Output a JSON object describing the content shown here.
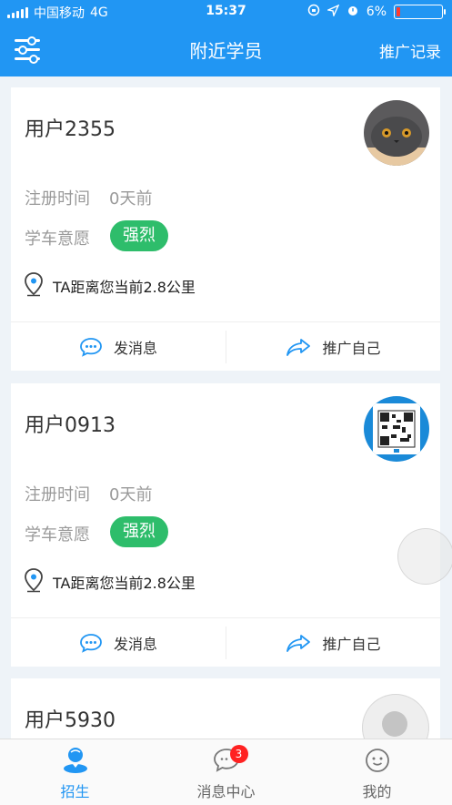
{
  "status_bar": {
    "carrier": "中国移动",
    "network": "4G",
    "time": "15:37",
    "battery": "6%",
    "battery_level": 0.06
  },
  "nav": {
    "title": "附近学员",
    "right_action": "推广记录",
    "menu_icon": "menu-sliders-icon"
  },
  "cards": [
    {
      "name": "用户2355",
      "reg_label": "注册时间",
      "reg_value": "0天前",
      "intent_label": "学车意愿",
      "intent_value": "强烈",
      "distance": "TA距离您当前2.8公里",
      "action_message": "发消息",
      "action_promote": "推广自己",
      "avatar": "cat-photo"
    },
    {
      "name": "用户0913",
      "reg_label": "注册时间",
      "reg_value": "0天前",
      "intent_label": "学车意愿",
      "intent_value": "强烈",
      "distance": "TA距离您当前2.8公里",
      "action_message": "发消息",
      "action_promote": "推广自己",
      "avatar": "qr-code"
    },
    {
      "name": "用户5930"
    }
  ],
  "tabs": [
    {
      "label": "招生",
      "icon": "recruit-person-icon",
      "active": true
    },
    {
      "label": "消息中心",
      "icon": "chat-bubble-icon",
      "badge": "3"
    },
    {
      "label": "我的",
      "icon": "smiley-face-icon"
    }
  ],
  "colors": {
    "primary": "#2196f3",
    "pill_green": "#2ebd6b",
    "badge_red": "#ff2222"
  }
}
